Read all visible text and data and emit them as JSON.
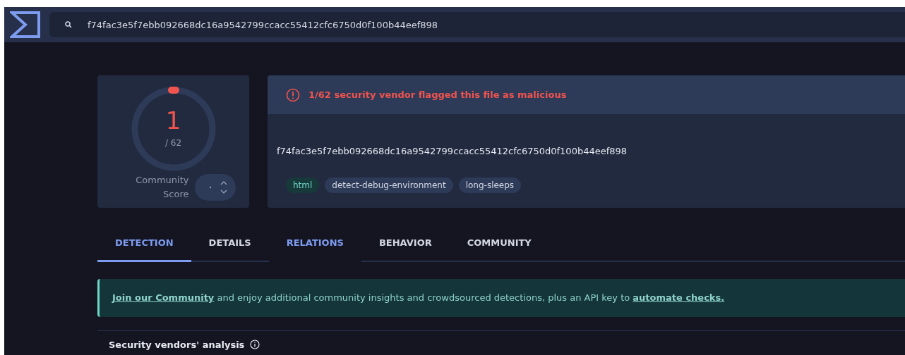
{
  "search": {
    "value": "f74fac3e5f7ebb092668dc16a9542799ccacc55412cfc6750d0f100b44eef898"
  },
  "score": {
    "detections": "1",
    "total": "/ 62",
    "community_label": "Community Score"
  },
  "summary": {
    "alert": "1/62 security vendor flagged this file as malicious",
    "hash": "f74fac3e5f7ebb092668dc16a9542799ccacc55412cfc6750d0f100b44eef898",
    "tags": [
      {
        "label": "html",
        "color": "#17393a"
      },
      {
        "label": "detect-debug-environment",
        "color": "#2d3a58"
      },
      {
        "label": "long-sleeps",
        "color": "#2d3a58"
      }
    ]
  },
  "tabs": [
    {
      "label": "DETECTION",
      "selected": true,
      "hovered": false
    },
    {
      "label": "DETAILS",
      "selected": false,
      "hovered": false
    },
    {
      "label": "RELATIONS",
      "selected": false,
      "hovered": true
    },
    {
      "label": "BEHAVIOR",
      "selected": false,
      "hovered": false
    },
    {
      "label": "COMMUNITY",
      "selected": false,
      "hovered": false
    }
  ],
  "banner": {
    "link": "Join our Community",
    "text": " and enjoy additional community insights and crowdsourced detections, plus an API key to ",
    "link_2": "automate checks."
  },
  "section": {
    "title": "Security vendors' analysis"
  }
}
